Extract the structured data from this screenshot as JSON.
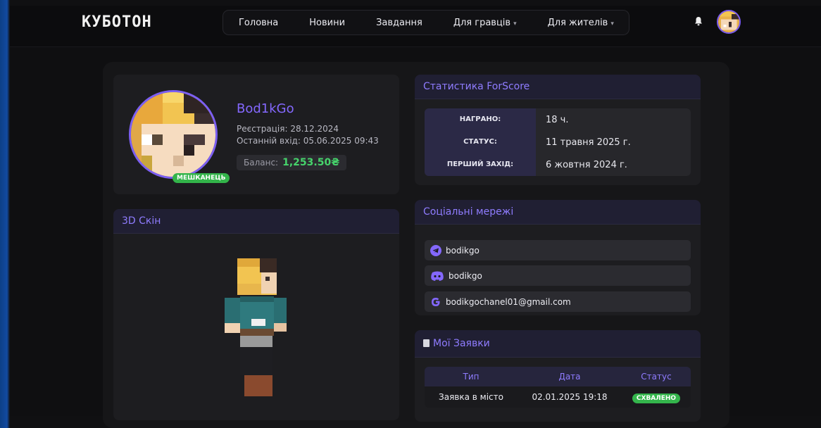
{
  "header": {
    "logo": "КУБОТОН",
    "nav": [
      {
        "label": "Головна",
        "dropdown": false
      },
      {
        "label": "Новини",
        "dropdown": false
      },
      {
        "label": "Завдання",
        "dropdown": false
      },
      {
        "label": "Для гравців",
        "dropdown": true
      },
      {
        "label": "Для жителів",
        "dropdown": true
      }
    ],
    "caret": "▾",
    "bell_icon": "bell-icon",
    "avatar_icon": "user-avatar"
  },
  "profile": {
    "username": "Bod1kGo",
    "registration": "Реєстрація: 28.12.2024",
    "last_login": "Останній вхід: 05.06.2025 09:43",
    "balance_label": "Баланс:",
    "balance_value": "1,253.50₴",
    "role_badge": "МЕШКАНЕЦЬ"
  },
  "skin": {
    "title": "3D Скін"
  },
  "stats": {
    "title": "Статистика ForScore",
    "rows": [
      {
        "label": "НАГРАНО:",
        "value": "18 ч."
      },
      {
        "label": "СТАТУС:",
        "value": "11 травня 2025 г."
      },
      {
        "label": "ПЕРШИЙ ЗАХІД:",
        "value": "6 жовтня 2024 г."
      }
    ]
  },
  "social": {
    "title": "Соціальні мережі",
    "items": [
      {
        "icon": "telegram-icon",
        "text": "bodikgo"
      },
      {
        "icon": "discord-icon",
        "text": "bodikgo"
      },
      {
        "icon": "google-icon",
        "text": "bodikgochanel01@gmail.com"
      }
    ]
  },
  "requests": {
    "title": "Мої Заявки",
    "columns": [
      "Тип",
      "Дата",
      "Статус"
    ],
    "rows": [
      {
        "type": "Заявка в місто",
        "date": "02.01.2025 19:18",
        "status": "СХВАЛЕНО"
      }
    ]
  },
  "colors": {
    "accent": "#8468ff",
    "success": "#34b54c",
    "balance": "#46d36b"
  }
}
